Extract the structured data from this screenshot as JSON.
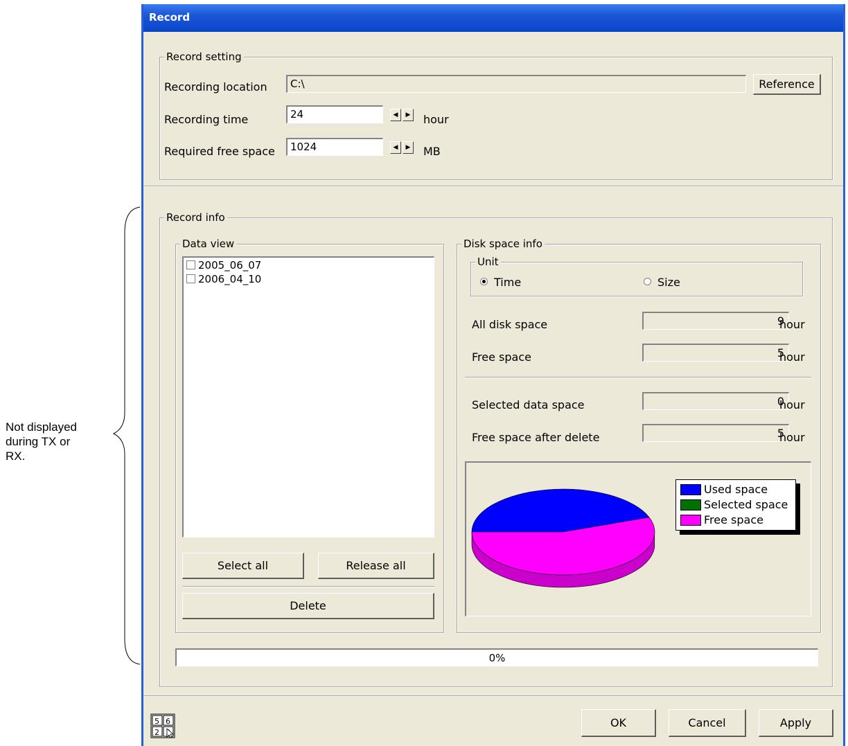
{
  "window": {
    "title": "Record"
  },
  "annotation": {
    "line1": "Not displayed",
    "line2": "during TX or",
    "line3": "RX."
  },
  "record_setting": {
    "legend": "Record setting",
    "location_label": "Recording location",
    "location_value": "C:\\",
    "reference_button": "Reference",
    "time_label": "Recording time",
    "time_value": "24",
    "time_unit": "hour",
    "free_label": "Required free space",
    "free_value": "1024",
    "free_unit": "MB"
  },
  "record_info": {
    "legend": "Record info",
    "data_view": {
      "legend": "Data view",
      "items": [
        "2005_06_07",
        "2006_04_10"
      ],
      "select_all": "Select all",
      "release_all": "Release all",
      "delete": "Delete"
    },
    "disk_space": {
      "legend": "Disk space info",
      "unit_legend": "Unit",
      "unit_time": "Time",
      "unit_size": "Size",
      "unit_selected": "Time",
      "all_disk_label": "All disk space",
      "all_disk_value": "9",
      "free_label": "Free space",
      "free_value": "5",
      "selected_label": "Selected data space",
      "selected_value": "0",
      "after_delete_label": "Free space after delete",
      "after_delete_value": "5",
      "unit_text": "hour"
    },
    "progress_text": "0%",
    "progress_fraction": 0
  },
  "chart_data": {
    "type": "pie",
    "legend_placement": "right",
    "labels": [
      "Used space",
      "Selected space",
      "Free space"
    ],
    "values": [
      4,
      0,
      5
    ],
    "colors": [
      "#0000ff",
      "#007000",
      "#ff00ff"
    ]
  },
  "buttons": {
    "ok": "OK",
    "cancel": "Cancel",
    "apply": "Apply"
  },
  "icons": {
    "corner": "numeric-keypad-icon"
  }
}
